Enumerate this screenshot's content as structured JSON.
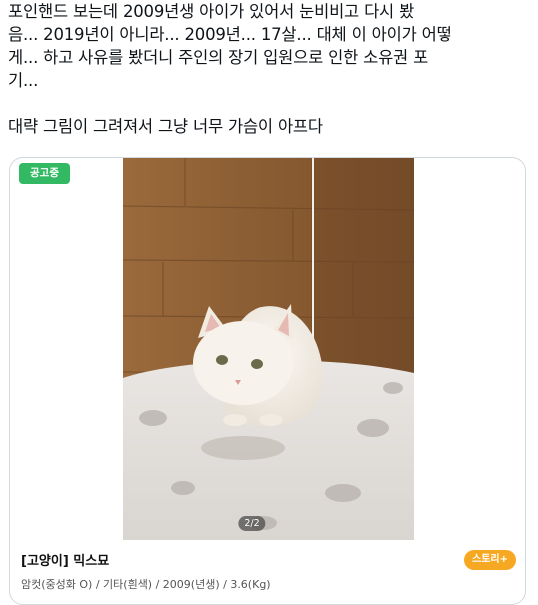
{
  "tweet": {
    "paragraph1": "포인핸드 보는데 2009년생 아이가 있어서 눈비비고 다시 봤\n음... 2019년이 아니라... 2009년... 17살... 대체 이 아이가 어떻\n게... 하고 사유를 봤더니 주인의 장기 입원으로 인한 소유권 포\n기...",
    "paragraph2": "대략 그림이 그려져서 그냥 너무 가슴이 아프다"
  },
  "card": {
    "status_badge": "공고중",
    "photo_counter": "2/2",
    "title": "[고양이] 믹스묘",
    "details": "암컷(중성화 O) / 기타(흰색) / 2009(년생) / 3.6(Kg)",
    "story_badge": "스토리+"
  },
  "colors": {
    "status_badge": "#33b864",
    "story_badge": "#f7a823",
    "card_border": "#cfd9de"
  }
}
